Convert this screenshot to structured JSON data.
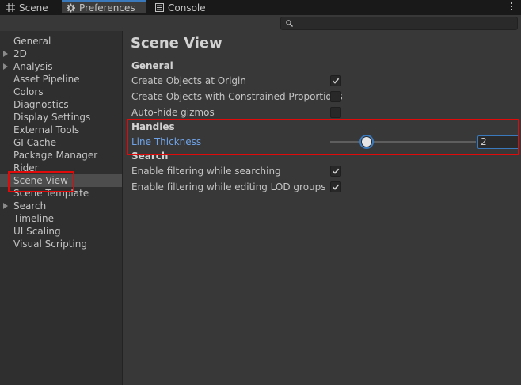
{
  "tabs": [
    {
      "label": "Scene",
      "icon": "grid-icon"
    },
    {
      "label": "Preferences",
      "icon": "gear-icon"
    },
    {
      "label": "Console",
      "icon": "console-icon"
    }
  ],
  "search": {
    "placeholder": "",
    "icon": "search-icon"
  },
  "sidebar": {
    "items": [
      {
        "label": "General"
      },
      {
        "label": "2D",
        "expandable": true
      },
      {
        "label": "Analysis",
        "expandable": true
      },
      {
        "label": "Asset Pipeline"
      },
      {
        "label": "Colors"
      },
      {
        "label": "Diagnostics"
      },
      {
        "label": "Display Settings"
      },
      {
        "label": "External Tools"
      },
      {
        "label": "GI Cache"
      },
      {
        "label": "Package Manager"
      },
      {
        "label": "Rider"
      },
      {
        "label": "Scene View",
        "selected": true
      },
      {
        "label": "Scene Template"
      },
      {
        "label": "Search",
        "expandable": true
      },
      {
        "label": "Timeline"
      },
      {
        "label": "UI Scaling"
      },
      {
        "label": "Visual Scripting"
      }
    ]
  },
  "main": {
    "title": "Scene View",
    "general": {
      "heading": "General",
      "rows": [
        {
          "label": "Create Objects at Origin",
          "checked": true
        },
        {
          "label": "Create Objects with Constrained Proportions",
          "checked": false
        },
        {
          "label": "Auto-hide gizmos",
          "checked": false
        }
      ]
    },
    "handles": {
      "heading": "Handles",
      "line_thickness_label": "Line Thickness",
      "line_thickness_value": "2",
      "slider_fraction": 0.25
    },
    "search": {
      "heading": "Search",
      "rows": [
        {
          "label": "Enable filtering while searching",
          "checked": true
        },
        {
          "label": "Enable filtering while editing LOD groups",
          "checked": true
        }
      ]
    }
  },
  "colors": {
    "accent": "#3a79bb",
    "highlight": "#e10a0a",
    "link": "#6fa2e6"
  }
}
